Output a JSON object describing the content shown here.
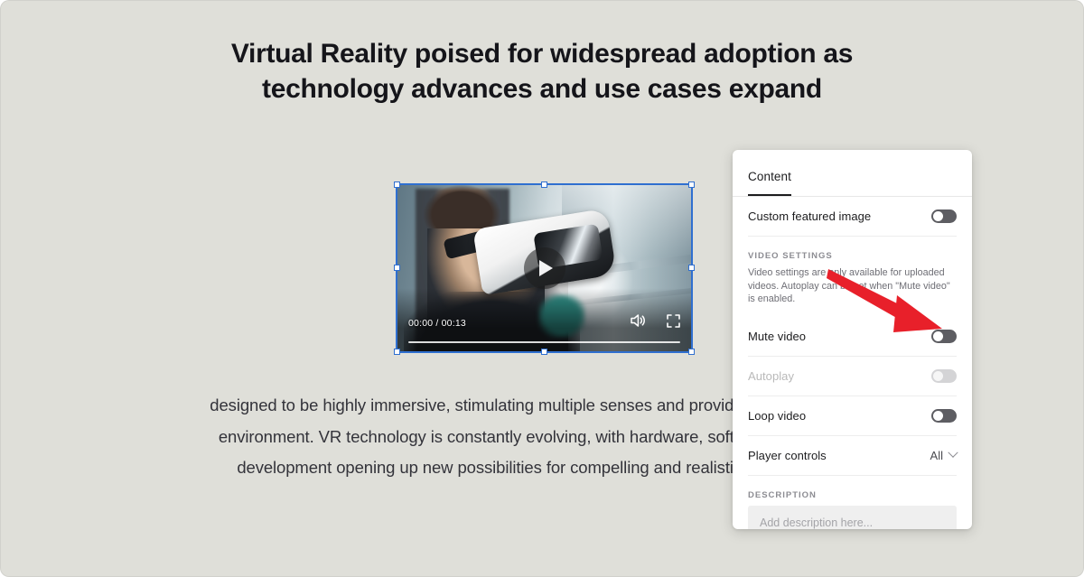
{
  "article": {
    "headline": "Virtual Reality poised for widespread adoption as technology advances and use cases expand",
    "body": "designed to be highly immersive, stimulating multiple senses and providing control over the environment. VR technology is constantly evolving, with hardware, software, and content development opening up new possibilities for compelling and realistic virtual worlds."
  },
  "video": {
    "timecode": "00:00 / 00:13",
    "play_icon": "play-icon",
    "volume_icon": "volume-icon",
    "fullscreen_icon": "fullscreen-icon",
    "selection_color": "#2f6fd0",
    "selected": "true"
  },
  "panel": {
    "tabs": [
      {
        "label": "Content",
        "active": true
      }
    ],
    "rows": [
      {
        "label": "Custom featured image",
        "control": "toggle",
        "state": "off",
        "disabled": false
      }
    ],
    "video_settings": {
      "section_label": "VIDEO SETTINGS",
      "helper_text": "Video settings are only available for uploaded videos. Autoplay can be set when \"Mute video\" is enabled.",
      "rows": [
        {
          "label": "Mute video",
          "control": "toggle",
          "state": "off",
          "disabled": false
        },
        {
          "label": "Autoplay",
          "control": "toggle",
          "state": "off",
          "disabled": true
        },
        {
          "label": "Loop video",
          "control": "toggle",
          "state": "off",
          "disabled": false
        },
        {
          "label": "Player controls",
          "control": "select",
          "value": "All",
          "disabled": false
        }
      ]
    },
    "description": {
      "section_label": "DESCRIPTION",
      "placeholder": "Add description here...",
      "value": ""
    }
  },
  "annotation": {
    "arrow_color": "#e8202a",
    "points_to": "Mute video toggle"
  },
  "colors": {
    "page_background": "#dfdfd9",
    "panel_background": "#ffffff",
    "accent": "#1c1c1e",
    "toggle_on_track": "#5d5d62",
    "toggle_disabled_track": "#d4d4d6"
  }
}
